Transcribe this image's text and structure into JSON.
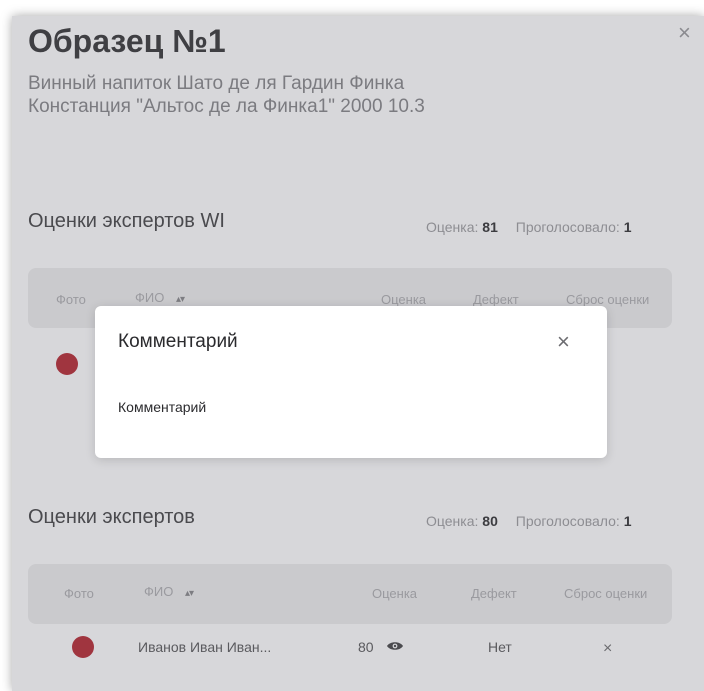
{
  "sample": {
    "title": "Образец №1",
    "subtitle_line1": "Винный напиток Шато де ля Гардин Финка",
    "subtitle_line2": "Констанция \"Альтос де ла Финка1\" 2000 10.3",
    "close_glyph": "×"
  },
  "section_wi": {
    "title": "Оценки экспертов WI",
    "score_label": "Оценка:",
    "score_value": "81",
    "voted_label": "Проголосовало:",
    "voted_value": "1",
    "columns": [
      "Фото",
      "ФИО",
      "Оценка",
      "Дефект",
      "Сброс оценки"
    ],
    "row": {
      "reset": "×"
    }
  },
  "section_experts": {
    "title": "Оценки экспертов",
    "score_label": "Оценка:",
    "score_value": "80",
    "voted_label": "Проголосовало:",
    "voted_value": "1",
    "columns": [
      "Фото",
      "ФИО",
      "Оценка",
      "Дефект",
      "Сброс оценки"
    ],
    "rows": [
      {
        "name": "Иванов Иван Иван...",
        "score": "80",
        "defect": "Нет",
        "reset": "×"
      }
    ]
  },
  "modal": {
    "title": "Комментарий",
    "body": "Комментарий",
    "close_glyph": "×"
  },
  "icons": {
    "sort": "sort-icon",
    "eye": "eye-icon",
    "avatar": "user-avatar-icon"
  },
  "colors": {
    "avatar": "#a0353f",
    "overlay_panel": "#d7d7da"
  }
}
